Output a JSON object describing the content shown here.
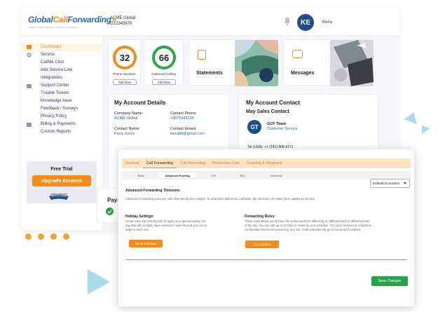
{
  "header": {
    "logo_text_1": "Global",
    "logo_text_2": "Call",
    "logo_text_3": "Forwarding",
    "logo_tagline": "Leaders In Global Telephony & Virtual Communication",
    "account_name": "ACME Global",
    "account_number": "G12345678",
    "user_initials": "KE",
    "user_name": "Keira"
  },
  "sidebar": {
    "items": [
      {
        "label": "Dashboard",
        "icon": "dashboard-icon",
        "active": true
      },
      {
        "label": "Service",
        "icon": "gear-icon"
      },
      {
        "label": "CallMe Click"
      },
      {
        "label": "Add Service Line"
      },
      {
        "label": "Integrations"
      },
      {
        "label": "Support Center",
        "icon": "chat-icon"
      },
      {
        "label": "Trouble Tickets"
      },
      {
        "label": "Knowledge base"
      },
      {
        "label": "Feedback / Surveys"
      },
      {
        "label": "Privacy Policy"
      },
      {
        "label": "Billing & Payments",
        "icon": "billing-icon"
      },
      {
        "label": "Custom Reports"
      }
    ],
    "trial_title": "Free Trial",
    "upgrade_label": "Upgrade Account",
    "partner_logo": "unitedcallcenter"
  },
  "stats": {
    "phone_numbers_value": "32",
    "phone_numbers_label": "Phone Numbers",
    "outbound_value": "66",
    "outbound_label": "Outbound Calling",
    "add_new_label": "Add New",
    "statements_label": "Statements",
    "messages_label": "Messages"
  },
  "account_details": {
    "title": "My Account Details",
    "company_label": "Company Name:",
    "company_value": "ACME Global",
    "contact_phone_label": "Contact Phone:",
    "contact_phone_value": "+9876543235",
    "contact_name_label": "Contact Name:",
    "contact_name_value": "Kiera Jones",
    "contact_email_label": "Contact Emaol:",
    "contact_email_value": "kiera88@gmail.com"
  },
  "account_contact": {
    "title": "My Account Contact",
    "subtitle": "May Sales Contact",
    "initials": "GT",
    "team": "GCF Team",
    "dept": "Customer Service",
    "tel": "Tel (USA): +1 (541) 908-6171"
  },
  "payment_partial": "Payn",
  "modal": {
    "tabs": [
      "General",
      "Call Forwarding",
      "Call Recording",
      "Restriction Lists",
      "Greeting & Ringback"
    ],
    "active_tab": 1,
    "subtabs": [
      "Basic",
      "Advanced Routing",
      "IVR",
      "PAX",
      "Voicemail"
    ],
    "active_subtab": 1,
    "timezone_value": "Default/US Eastern",
    "adv_title": "Advanced Forwarding Timezone:",
    "adv_desc": "Advanced Forwarding rules are rules that specify time ranges. To avoid time difference confusion, the timezone you select here applies to all rules.",
    "holiday_title": "Holiday Settings:",
    "holiday_desc_1": "Create your own holiday lists to apply as a special routing rule.",
    "holiday_desc_2": "day lists with multiple days selected in each list and you can ch",
    "holiday_desc_3": "apply in each rule.",
    "holiday_btn": "Go to Holidays",
    "rules_title": "Forwarding Rules:",
    "rules_desc_1": "These rules allows you to have the system perform differently on different days or different hours",
    "rules_desc_2": "of the day. You can add up to 10 rules to make up your schedule. If a call is received at a day/time",
    "rules_desc_3": "combination that is not covered by any rule, it will automatically go to voicemail if enabled.",
    "rules_btn": "Go to Rules",
    "save_btn": "Save Changes"
  },
  "colors": {
    "accent": "#f28c1a",
    "brand_blue": "#1f4e8c",
    "save_green": "#27a24a",
    "deco_teal": "#a8dcec"
  }
}
